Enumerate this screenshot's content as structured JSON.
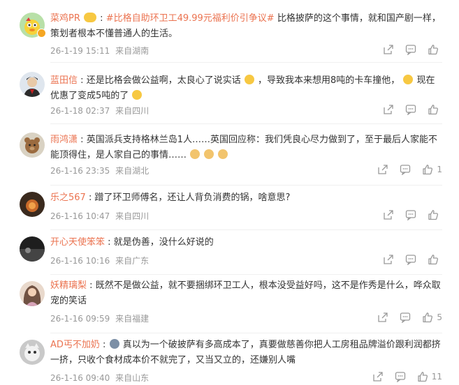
{
  "comments": [
    {
      "name": "菜鸡PR",
      "tag": "#比格自助环卫工49.99元福利价引争议#",
      "text": " 比格披萨的这个事情，就和国产剧一样，策划者根本不懂普通人的生活。",
      "time": "26-1-19 15:11",
      "location": "来自湖南",
      "likes": ""
    },
    {
      "name": "蓝田信",
      "text": "还是比格会做公益啊，太良心了说实话",
      "text2": "，导致我本来想用8吨的卡车撞他，",
      "text3": "现在优惠了变成5吨的了",
      "time": "26-1-18 02:37",
      "location": "来自四川",
      "likes": ""
    },
    {
      "name": "雨鸿潇",
      "text": "英国派兵支持格林兰岛1人……英国回应称：我们凭良心尽力做到了，至于最后人家能不能顶得住，是人家自己的事情……",
      "time": "26-1-16 23:35",
      "location": "来自湖北",
      "likes": "1"
    },
    {
      "name": "乐之567",
      "text": "蹭了环卫师傅名，还让人背负消费的锅，啥意思?",
      "time": "26-1-16 10:47",
      "location": "来自四川",
      "likes": ""
    },
    {
      "name": "开心天使笨笨",
      "text": "就是伪善，没什么好说的",
      "time": "26-1-16 10:16",
      "location": "来自广东",
      "likes": ""
    },
    {
      "name": "妖精璃梨",
      "text": "既然不是做公益，就不要捆绑环卫工人，根本没受益好吗，这不是作秀是什么，哗众取宠的笑话",
      "time": "26-1-16 09:59",
      "location": "来自福建",
      "likes": "5"
    },
    {
      "name": "AD丐不加奶",
      "text": "真以为一个破披萨有多高成本了，真要做慈善你把人工房租品牌溢价跟利润都挤一挤，只收个食材成本价不就完了，又当又立的，还嫌别人嘴",
      "time": "26-1-16 09:40",
      "location": "来自山东",
      "likes": "11"
    }
  ],
  "colors": {
    "accent": "#eb7350",
    "meta": "#999999",
    "text": "#333333"
  }
}
